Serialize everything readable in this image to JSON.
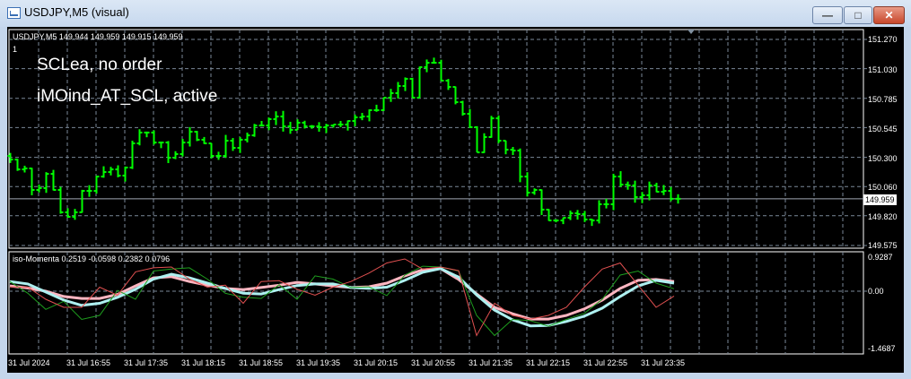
{
  "window": {
    "title": "USDJPY,M5 (visual)",
    "minimize": "—",
    "maximize": "□",
    "close": "✕"
  },
  "chart": {
    "info": "USDJPY,M5  149.944 149.959 149.915 149.959",
    "marker": "1",
    "comments": [
      "SCLea, no order",
      "iMOind_AT_SCL, active"
    ],
    "current_price": "149.959",
    "price_ticks": [
      "151.270",
      "151.030",
      "150.785",
      "150.545",
      "150.300",
      "150.060",
      "149.820",
      "149.575"
    ],
    "indicator_label": "iso-Momenta 0.2519 -0.0598 0.2382 0.0796",
    "indicator_ticks": [
      "0.9287",
      "0.00",
      "-1.4687"
    ],
    "time_labels": [
      "31 Jul 2024",
      "31 Jul 16:55",
      "31 Jul 17:35",
      "31 Jul 18:15",
      "31 Jul 18:55",
      "31 Jul 19:35",
      "31 Jul 20:15",
      "31 Jul 20:55",
      "31 Jul 21:35",
      "31 Jul 22:15",
      "31 Jul 22:55",
      "31 Jul 23:35"
    ]
  },
  "chart_data": [
    {
      "type": "line",
      "title": "USDJPY,M5 bars (close)",
      "ylim": [
        149.575,
        151.27
      ],
      "bar_color": "#00ff00",
      "closes": [
        150.282,
        150.201,
        150.209,
        150.032,
        150.047,
        150.164,
        150.032,
        149.848,
        149.811,
        149.848,
        150.024,
        150.024,
        150.142,
        150.179,
        150.201,
        150.15,
        150.216,
        150.415,
        150.504,
        150.504,
        150.422,
        150.422,
        150.297,
        150.327,
        150.422,
        150.511,
        150.445,
        150.415,
        150.312,
        150.312,
        150.437,
        150.378,
        150.445,
        150.481,
        150.562,
        150.562,
        150.614,
        150.636,
        150.555,
        150.526,
        150.585,
        150.555,
        150.555,
        150.548,
        150.562,
        150.57,
        150.57,
        150.599,
        150.629,
        150.636,
        150.688,
        150.688,
        150.791,
        150.828,
        150.887,
        150.946,
        150.791,
        151.042,
        151.078,
        151.078,
        150.931,
        150.879,
        150.754,
        150.658,
        150.548,
        150.341,
        150.467,
        150.621,
        150.437,
        150.363,
        150.356,
        150.142,
        150.01,
        150.032,
        149.87,
        149.781,
        149.781,
        149.803,
        149.84,
        149.833,
        149.789,
        149.781,
        149.914,
        149.914,
        150.142,
        150.076,
        150.069,
        149.973,
        149.988,
        150.069,
        150.017,
        150.024,
        149.959,
        149.959
      ]
    },
    {
      "type": "line",
      "title": "iso-Momenta",
      "ylim": [
        -1.4687,
        0.9287
      ],
      "x_step_bars": 2.5,
      "series": [
        {
          "name": "pink",
          "color": "#ffb6c1",
          "width": 3,
          "values": [
            0.13,
            0.08,
            0.0,
            -0.13,
            -0.18,
            -0.18,
            -0.08,
            0.13,
            0.33,
            0.36,
            0.24,
            0.15,
            0.07,
            0.04,
            0.09,
            0.15,
            0.22,
            0.18,
            0.13,
            0.09,
            0.11,
            0.2,
            0.38,
            0.53,
            0.56,
            0.29,
            -0.07,
            -0.4,
            -0.56,
            -0.69,
            -0.69,
            -0.6,
            -0.44,
            -0.22,
            0.07,
            0.27,
            0.29,
            0.24
          ]
        },
        {
          "name": "cyan",
          "color": "#aef0f0",
          "width": 3,
          "values": [
            0.24,
            0.18,
            -0.02,
            -0.22,
            -0.35,
            -0.3,
            -0.15,
            0.05,
            0.3,
            0.42,
            0.33,
            0.2,
            0.07,
            -0.05,
            -0.07,
            0.04,
            0.14,
            0.18,
            0.18,
            0.09,
            0.07,
            0.1,
            0.27,
            0.47,
            0.56,
            0.35,
            -0.09,
            -0.47,
            -0.71,
            -0.86,
            -0.85,
            -0.75,
            -0.62,
            -0.42,
            -0.13,
            0.13,
            0.27,
            0.2
          ]
        },
        {
          "name": "green",
          "color": "#1e9e1e",
          "width": 1,
          "values": [
            0.24,
            -0.05,
            -0.45,
            -0.25,
            -0.7,
            -0.6,
            0.02,
            -0.2,
            0.5,
            0.55,
            0.58,
            0.3,
            -0.05,
            -0.15,
            -0.18,
            0.16,
            -0.2,
            0.38,
            0.3,
            0.09,
            0.11,
            -0.11,
            0.4,
            0.62,
            0.6,
            0.5,
            -0.6,
            -1.1,
            -0.7,
            -0.73,
            -0.87,
            -0.7,
            -0.55,
            -0.2,
            0.4,
            0.5,
            0.2,
            0.06
          ]
        },
        {
          "name": "red",
          "color": "#e05050",
          "width": 1,
          "values": [
            0.11,
            0.1,
            -0.2,
            -0.4,
            -0.4,
            0.1,
            -0.1,
            0.48,
            0.58,
            0.6,
            0.3,
            0.1,
            0.15,
            -0.3,
            0.24,
            0.26,
            0.05,
            -0.1,
            0.1,
            0.24,
            0.45,
            0.7,
            0.8,
            0.55,
            0.6,
            0.51,
            -1.1,
            -0.3,
            -0.6,
            -0.69,
            -0.6,
            -0.4,
            0.1,
            0.55,
            0.7,
            0.15,
            -0.4,
            -0.12
          ]
        }
      ]
    }
  ]
}
